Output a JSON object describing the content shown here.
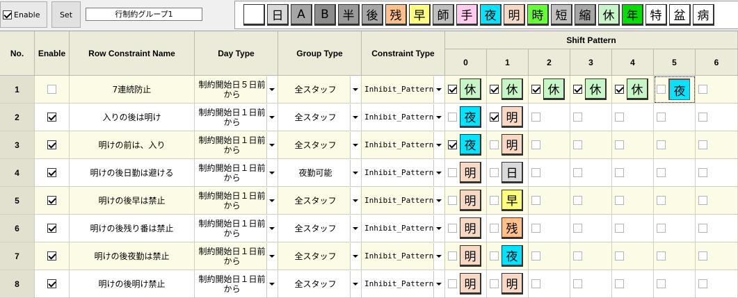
{
  "toolbar": {
    "enable_label": "Enable",
    "enable_checked": true,
    "set_label": "Set",
    "group_name": "行制約グループ1"
  },
  "palette": [
    {
      "label": "",
      "bg": "#ffffff",
      "fg": "#000000"
    },
    {
      "label": "日",
      "bg": "#d9d9d9",
      "fg": "#000000"
    },
    {
      "label": "A",
      "bg": "#a6a6a6",
      "fg": "#000000"
    },
    {
      "label": "B",
      "bg": "#8c8c8c",
      "fg": "#000000"
    },
    {
      "label": "半",
      "bg": "#999999",
      "fg": "#000000"
    },
    {
      "label": "後",
      "bg": "#a6a6a6",
      "fg": "#000000"
    },
    {
      "label": "残",
      "bg": "#ffc08c",
      "fg": "#000000"
    },
    {
      "label": "早",
      "bg": "#ffff80",
      "fg": "#000000"
    },
    {
      "label": "師",
      "bg": "#bfbfbf",
      "fg": "#000000"
    },
    {
      "label": "手",
      "bg": "#ffccf0",
      "fg": "#000000"
    },
    {
      "label": "夜",
      "bg": "#00e5ff",
      "fg": "#000000"
    },
    {
      "label": "明",
      "bg": "#f5d9c5",
      "fg": "#000000"
    },
    {
      "label": "時",
      "bg": "#66ff33",
      "fg": "#000000"
    },
    {
      "label": "短",
      "bg": "#c0c0c0",
      "fg": "#000000"
    },
    {
      "label": "縮",
      "bg": "#a6a6a6",
      "fg": "#000000"
    },
    {
      "label": "休",
      "bg": "#c8f5c8",
      "fg": "#000000"
    },
    {
      "label": "年",
      "bg": "#00e000",
      "fg": "#000000"
    },
    {
      "label": "特",
      "bg": "#ffffff",
      "fg": "#000000"
    },
    {
      "label": "盆",
      "bg": "#ffffff",
      "fg": "#000000"
    },
    {
      "label": "病",
      "bg": "#ffffff",
      "fg": "#000000"
    }
  ],
  "headers": {
    "no": "No.",
    "enable": "Enable",
    "row_constraint_name": "Row Constraint Name",
    "day_type": "Day Type",
    "group_type": "Group Type",
    "constraint_type": "Constraint Type",
    "shift_pattern": "Shift Pattern",
    "pattern_cols": [
      "0",
      "1",
      "2",
      "3",
      "4",
      "5",
      "6"
    ]
  },
  "rows": [
    {
      "no": "1",
      "enabled": false,
      "name": "7連続防止",
      "day_type": "制約開始日５日前から",
      "group_type": "全スタッフ",
      "constraint_type": "Inhibit_Pattern",
      "pattern": [
        {
          "checked": true,
          "shift": "休"
        },
        {
          "checked": true,
          "shift": "休"
        },
        {
          "checked": true,
          "shift": "休"
        },
        {
          "checked": true,
          "shift": "休"
        },
        {
          "checked": true,
          "shift": "休"
        },
        {
          "checked": false,
          "shift": "夜",
          "selected": true
        },
        {
          "checked": false,
          "shift": ""
        }
      ]
    },
    {
      "no": "2",
      "enabled": true,
      "name": "入りの後は明け",
      "day_type": "制約開始日１日前から",
      "group_type": "全スタッフ",
      "constraint_type": "Inhibit_Pattern",
      "pattern": [
        {
          "checked": false,
          "shift": "夜"
        },
        {
          "checked": true,
          "shift": "明"
        },
        {
          "checked": false,
          "shift": ""
        },
        {
          "checked": false,
          "shift": ""
        },
        {
          "checked": false,
          "shift": ""
        },
        {
          "checked": false,
          "shift": ""
        },
        {
          "checked": false,
          "shift": ""
        }
      ]
    },
    {
      "no": "3",
      "enabled": true,
      "name": "明けの前は、入り",
      "day_type": "制約開始日１日前から",
      "group_type": "全スタッフ",
      "constraint_type": "Inhibit_Pattern",
      "pattern": [
        {
          "checked": true,
          "shift": "夜"
        },
        {
          "checked": false,
          "shift": "明"
        },
        {
          "checked": false,
          "shift": ""
        },
        {
          "checked": false,
          "shift": ""
        },
        {
          "checked": false,
          "shift": ""
        },
        {
          "checked": false,
          "shift": ""
        },
        {
          "checked": false,
          "shift": ""
        }
      ]
    },
    {
      "no": "4",
      "enabled": true,
      "name": "明けの後日勤は避ける",
      "day_type": "制約開始日１日前から",
      "group_type": "夜勤可能",
      "constraint_type": "Inhibit_Pattern",
      "pattern": [
        {
          "checked": false,
          "shift": "明"
        },
        {
          "checked": false,
          "shift": "日"
        },
        {
          "checked": false,
          "shift": ""
        },
        {
          "checked": false,
          "shift": ""
        },
        {
          "checked": false,
          "shift": ""
        },
        {
          "checked": false,
          "shift": ""
        },
        {
          "checked": false,
          "shift": ""
        }
      ]
    },
    {
      "no": "5",
      "enabled": true,
      "name": "明けの後早は禁止",
      "day_type": "制約開始日１日前から",
      "group_type": "全スタッフ",
      "constraint_type": "Inhibit_Pattern",
      "pattern": [
        {
          "checked": false,
          "shift": "明"
        },
        {
          "checked": false,
          "shift": "早"
        },
        {
          "checked": false,
          "shift": ""
        },
        {
          "checked": false,
          "shift": ""
        },
        {
          "checked": false,
          "shift": ""
        },
        {
          "checked": false,
          "shift": ""
        },
        {
          "checked": false,
          "shift": ""
        }
      ]
    },
    {
      "no": "6",
      "enabled": true,
      "name": "明けの後残り番は禁止",
      "day_type": "制約開始日１日前から",
      "group_type": "全スタッフ",
      "constraint_type": "Inhibit_Pattern",
      "pattern": [
        {
          "checked": false,
          "shift": "明"
        },
        {
          "checked": false,
          "shift": "残"
        },
        {
          "checked": false,
          "shift": ""
        },
        {
          "checked": false,
          "shift": ""
        },
        {
          "checked": false,
          "shift": ""
        },
        {
          "checked": false,
          "shift": ""
        },
        {
          "checked": false,
          "shift": ""
        }
      ]
    },
    {
      "no": "7",
      "enabled": true,
      "name": "明けの後夜勤は禁止",
      "day_type": "制約開始日１日前から",
      "group_type": "全スタッフ",
      "constraint_type": "Inhibit_Pattern",
      "pattern": [
        {
          "checked": false,
          "shift": "明"
        },
        {
          "checked": false,
          "shift": "夜"
        },
        {
          "checked": false,
          "shift": ""
        },
        {
          "checked": false,
          "shift": ""
        },
        {
          "checked": false,
          "shift": ""
        },
        {
          "checked": false,
          "shift": ""
        },
        {
          "checked": false,
          "shift": ""
        }
      ]
    },
    {
      "no": "8",
      "enabled": true,
      "name": "明けの後明け禁止",
      "day_type": "制約開始日１日前から",
      "group_type": "全スタッフ",
      "constraint_type": "Inhibit_Pattern",
      "pattern": [
        {
          "checked": false,
          "shift": "明"
        },
        {
          "checked": false,
          "shift": "明"
        },
        {
          "checked": false,
          "shift": ""
        },
        {
          "checked": false,
          "shift": ""
        },
        {
          "checked": false,
          "shift": ""
        },
        {
          "checked": false,
          "shift": ""
        },
        {
          "checked": false,
          "shift": ""
        }
      ]
    }
  ]
}
